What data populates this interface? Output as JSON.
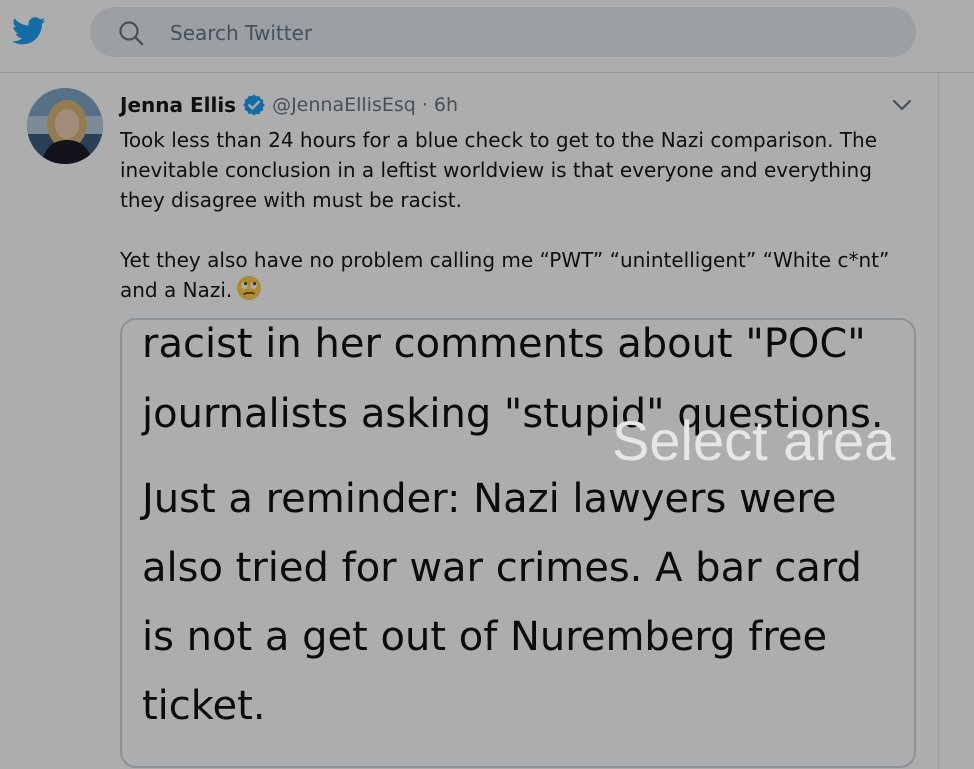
{
  "app": {
    "brand_color": "#1DA1F2",
    "logo_icon": "twitter-bird-icon"
  },
  "search": {
    "placeholder": "Search Twitter",
    "value": "",
    "icon": "search-icon"
  },
  "tweet": {
    "author_name": "Jenna Ellis",
    "verified": true,
    "handle": "@JennaEllisEsq",
    "separator": "·",
    "time": "6h",
    "paragraph1": "Took less than 24 hours for a blue check to get to the Nazi comparison. The inevitable conclusion in a leftist worldview is that everyone and everything they disagree with must be racist.",
    "paragraph2": "Yet they also have no problem calling me “PWT” “unintelligent” “White c*nt” and a Nazi.",
    "emoji_icon": "rolling-eyes-emoji-icon",
    "menu_icon": "chevron-down-icon",
    "media_lines": [
      "racist in her comments about \"POC\"",
      "journalists asking \"stupid\" questions.",
      "Just a reminder: Nazi lawyers were",
      "also tried for war crimes. A bar card",
      "is not a get out of Nuremberg free",
      "ticket."
    ]
  },
  "overlay": {
    "label": "Select area"
  }
}
